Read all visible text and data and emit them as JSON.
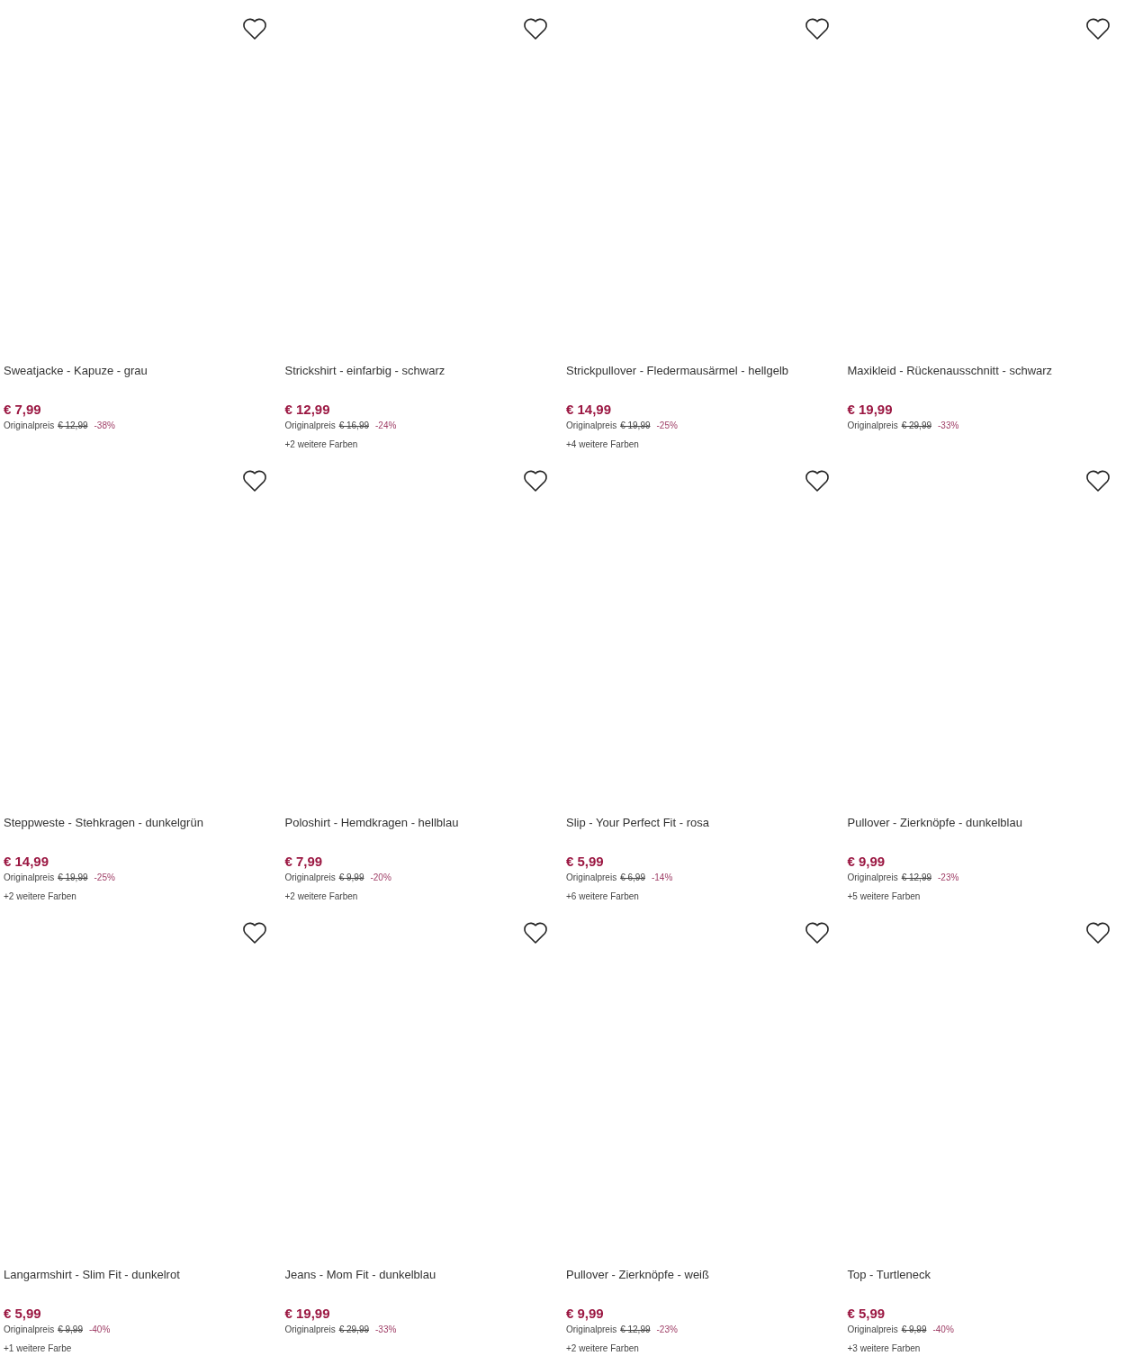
{
  "products": [
    {
      "title": "Sweatjacke - Kapuze - grau",
      "price": "€ 7,99",
      "original_label": "Originalpreis",
      "original_price": "€ 12,99",
      "discount": "-38%"
    },
    {
      "title": "Strickshirt - einfarbig - schwarz",
      "price": "€ 12,99",
      "original_label": "Originalpreis",
      "original_price": "€ 16,99",
      "discount": "-24%",
      "more_colors": "+2 weitere Farben"
    },
    {
      "title": "Strickpullover - Fledermausärmel - hellgelb",
      "price": "€ 14,99",
      "original_label": "Originalpreis",
      "original_price": "€ 19,99",
      "discount": "-25%",
      "more_colors": "+4 weitere Farben"
    },
    {
      "title": "Maxikleid - Rückenausschnitt - schwarz",
      "price": "€ 19,99",
      "original_label": "Originalpreis",
      "original_price": "€ 29,99",
      "discount": "-33%"
    },
    {
      "title": "Steppweste - Stehkragen - dunkelgrün",
      "price": "€ 14,99",
      "original_label": "Originalpreis",
      "original_price": "€ 19,99",
      "discount": "-25%",
      "more_colors": "+2 weitere Farben"
    },
    {
      "title": "Poloshirt - Hemdkragen - hellblau",
      "price": "€ 7,99",
      "original_label": "Originalpreis",
      "original_price": "€ 9,99",
      "discount": "-20%",
      "more_colors": "+2 weitere Farben"
    },
    {
      "title": "Slip - Your Perfect Fit - rosa",
      "price": "€ 5,99",
      "original_label": "Originalpreis",
      "original_price": "€ 6,99",
      "discount": "-14%",
      "more_colors": "+6 weitere Farben"
    },
    {
      "title": "Pullover - Zierknöpfe - dunkelblau",
      "price": "€ 9,99",
      "original_label": "Originalpreis",
      "original_price": "€ 12,99",
      "discount": "-23%",
      "more_colors": "+5 weitere Farben"
    },
    {
      "title": "Langarmshirt - Slim Fit - dunkelrot",
      "price": "€ 5,99",
      "original_label": "Originalpreis",
      "original_price": "€ 9,99",
      "discount": "-40%",
      "more_colors": "+1 weitere Farbe"
    },
    {
      "title": "Jeans - Mom Fit - dunkelblau",
      "price": "€ 19,99",
      "original_label": "Originalpreis",
      "original_price": "€ 29,99",
      "discount": "-33%"
    },
    {
      "title": "Pullover - Zierknöpfe - weiß",
      "price": "€ 9,99",
      "original_label": "Originalpreis",
      "original_price": "€ 12,99",
      "discount": "-23%",
      "more_colors": "+2 weitere Farben"
    },
    {
      "title": "Top - Turtleneck",
      "price": "€ 5,99",
      "original_label": "Originalpreis",
      "original_price": "€ 9,99",
      "discount": "-40%",
      "more_colors": "+3 weitere Farben"
    }
  ]
}
